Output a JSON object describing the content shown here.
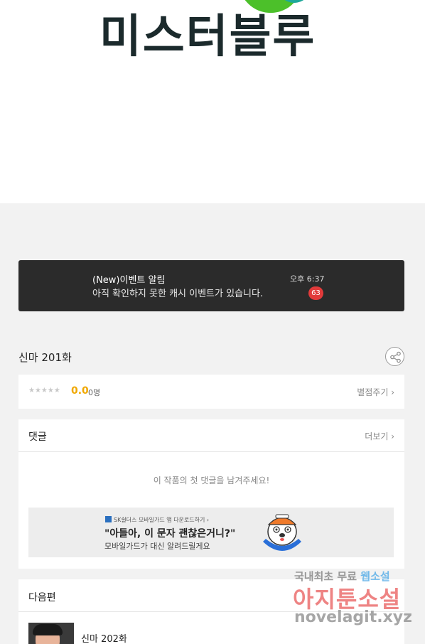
{
  "hero": {
    "title": "미스터블루"
  },
  "notice": {
    "title": "(New)이벤트 알림",
    "message": "아직 확인하지 못한 캐시 이벤트가 있습니다.",
    "time": "오후 6:37",
    "badge": "63"
  },
  "episode": {
    "title": "신마 201화"
  },
  "rating": {
    "stars": "★★★★★",
    "score": "0.0",
    "count": "0명",
    "rate_link": "별점주기 ›"
  },
  "comments": {
    "heading": "댓글",
    "more_link": "더보기 ›",
    "empty_message": "이 작품의 첫 댓글을 남겨주세요!"
  },
  "ad": {
    "brand": "SK쉴더스 모바일가드 앱 다운로드하기 ›",
    "headline": "\"아들아, 이 문자 괜찮은거니?\"",
    "sub": "모바일가드가 대신 알려드릴게요"
  },
  "next": {
    "heading": "다음편",
    "episode": "신마 202화"
  },
  "watermark": {
    "line1_a": "국내최초 무료",
    "line1_b": "웹소설",
    "line2": "아지툰소설",
    "line3": "novelagit.xyz"
  },
  "colors": {
    "score": "#f0a800",
    "badge": "#e23b3b",
    "notice_bg": "#2b2b2b"
  }
}
